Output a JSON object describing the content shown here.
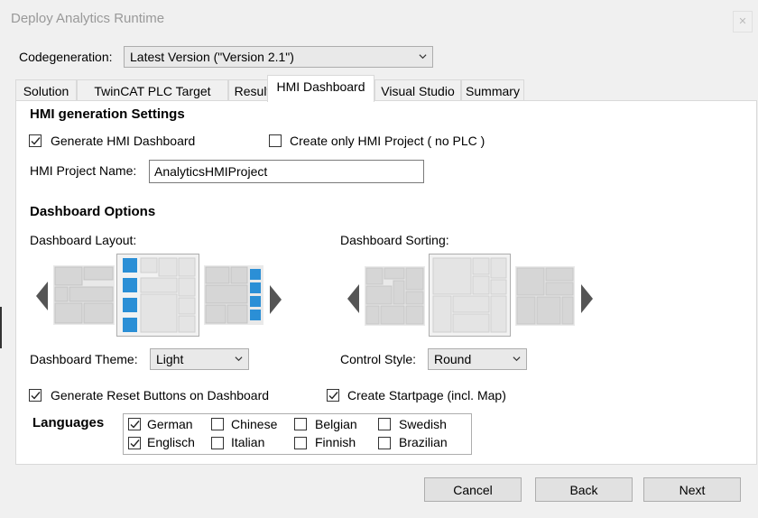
{
  "window": {
    "title": "Deploy Analytics Runtime"
  },
  "codegen": {
    "label": "Codegeneration:",
    "value": "Latest Version (\"Version 2.1\")"
  },
  "tabs": [
    "Solution",
    "TwinCAT PLC Target",
    "Results",
    "HMI Dashboard",
    "Visual Studio",
    "Summary"
  ],
  "active_tab": "HMI Dashboard",
  "hmi": {
    "section_title": "HMI generation Settings",
    "generate_dashboard": {
      "label": "Generate HMI Dashboard",
      "checked": true
    },
    "only_project": {
      "label": "Create only HMI Project ( no PLC )",
      "checked": false
    },
    "project_name_label": "HMI Project Name:",
    "project_name_value": "AnalyticsHMIProject"
  },
  "dashboard": {
    "section_title": "Dashboard Options",
    "layout_label": "Dashboard Layout:",
    "sorting_label": "Dashboard Sorting:",
    "theme_label": "Dashboard Theme:",
    "theme_value": "Light",
    "control_style_label": "Control Style:",
    "control_style_value": "Round",
    "reset_buttons": {
      "label": "Generate Reset Buttons on Dashboard",
      "checked": true
    },
    "startpage": {
      "label": "Create Startpage (incl. Map)",
      "checked": true
    }
  },
  "languages": {
    "label": "Languages",
    "items": [
      {
        "name": "German",
        "checked": true
      },
      {
        "name": "Chinese",
        "checked": false
      },
      {
        "name": "Belgian",
        "checked": false
      },
      {
        "name": "Swedish",
        "checked": false
      },
      {
        "name": "Englisch",
        "checked": true
      },
      {
        "name": "Italian",
        "checked": false
      },
      {
        "name": "Finnish",
        "checked": false
      },
      {
        "name": "Brazilian",
        "checked": false
      }
    ]
  },
  "buttons": {
    "cancel": "Cancel",
    "back": "Back",
    "next": "Next"
  },
  "colors": {
    "accent_blue": "#2b8fd6",
    "thumb_gray": "#d6d6d6",
    "thumb_light": "#e9e9e9"
  }
}
